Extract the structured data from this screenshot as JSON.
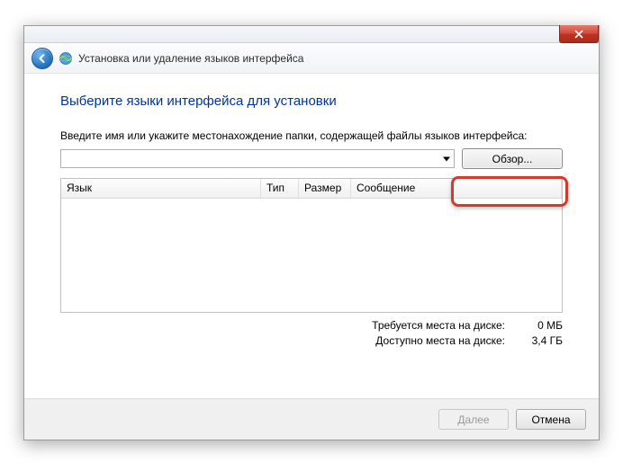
{
  "window": {
    "title": "Установка или удаление языков интерфейса"
  },
  "page": {
    "heading": "Выберите языки интерфейса для установки",
    "instruction": "Введите имя или укажите местонахождение папки, содержащей файлы языков интерфейса:"
  },
  "path_input": {
    "value": "",
    "browse_label": "Обзор..."
  },
  "listview": {
    "columns": {
      "language": "Язык",
      "type": "Тип",
      "size": "Размер",
      "message": "Сообщение"
    }
  },
  "disk": {
    "required_label": "Требуется места на диске:",
    "required_value": "0 МБ",
    "available_label": "Доступно места на диске:",
    "available_value": "3,4 ГБ"
  },
  "footer": {
    "next_label": "Далее",
    "cancel_label": "Отмена"
  },
  "highlight": {
    "target": "browse-button"
  }
}
